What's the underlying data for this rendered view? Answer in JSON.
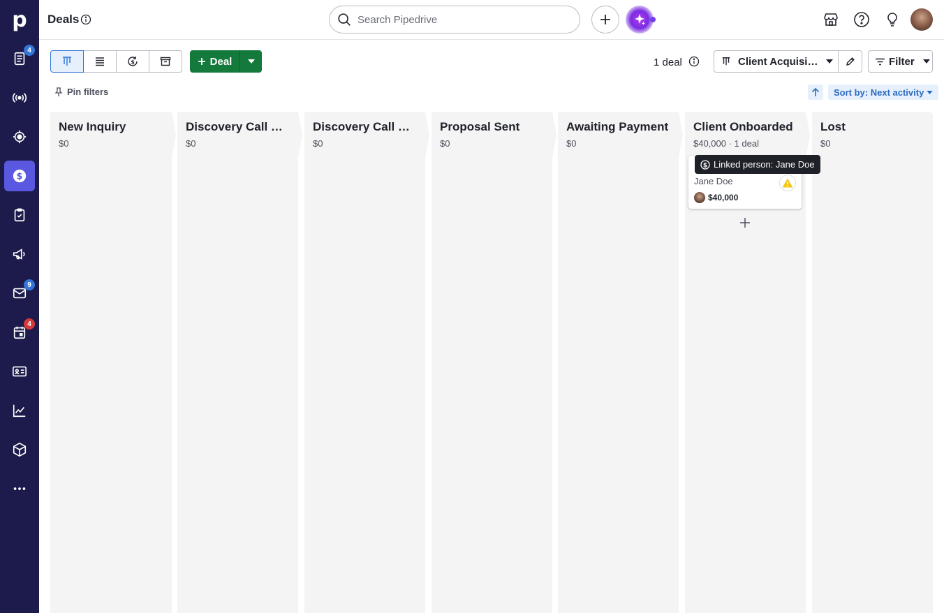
{
  "app": {
    "logo": "p",
    "page_title": "Deals",
    "search_placeholder": "Search Pipedrive"
  },
  "sidebar": {
    "items": [
      {
        "id": "leads",
        "icon": "leads-inbox-icon",
        "badge": "4",
        "badge_color": "#3176d8"
      },
      {
        "id": "broadcast",
        "icon": "broadcast-icon"
      },
      {
        "id": "target",
        "icon": "target-icon"
      },
      {
        "id": "deals",
        "icon": "dollar-icon",
        "active": true
      },
      {
        "id": "tasks",
        "icon": "clipboard-check-icon"
      },
      {
        "id": "campaigns",
        "icon": "megaphone-icon"
      },
      {
        "id": "mail",
        "icon": "mail-icon",
        "badge": "9",
        "badge_color": "#3176d8"
      },
      {
        "id": "calendar",
        "icon": "calendar-icon",
        "badge": "4",
        "badge_color": "#d43a3a"
      },
      {
        "id": "contacts",
        "icon": "contact-card-icon"
      },
      {
        "id": "insights",
        "icon": "chart-line-icon"
      },
      {
        "id": "products",
        "icon": "cube-icon"
      },
      {
        "id": "more",
        "icon": "more-icon"
      }
    ]
  },
  "toolbar": {
    "deal_button_label": "Deal",
    "deal_count": "1 deal",
    "pipeline_name": "Client Acquisition",
    "filter_label": "Filter",
    "pin_filters_label": "Pin filters",
    "sort_label": "Sort by: Next activity"
  },
  "stages": [
    {
      "title": "New Inquiry",
      "sub": "$0"
    },
    {
      "title": "Discovery Call Booked",
      "sub": "$0"
    },
    {
      "title": "Discovery Call Completed",
      "sub": "$0"
    },
    {
      "title": "Proposal Sent",
      "sub": "$0"
    },
    {
      "title": "Awaiting Payment",
      "sub": "$0"
    },
    {
      "title": "Client Onboarded",
      "sub": "$40,000 · 1 deal"
    },
    {
      "title": "Lost",
      "sub": "$0"
    }
  ],
  "card": {
    "person": "Jane Doe",
    "value": "$40,000",
    "tooltip": "Linked person: Jane Doe"
  },
  "colors": {
    "sidebar_bg": "#1c1b4b",
    "active_nav": "#5a57e0",
    "deal_green": "#137a3c",
    "accent_blue": "#3176d8",
    "stage_bg": "#f4f4f4"
  }
}
